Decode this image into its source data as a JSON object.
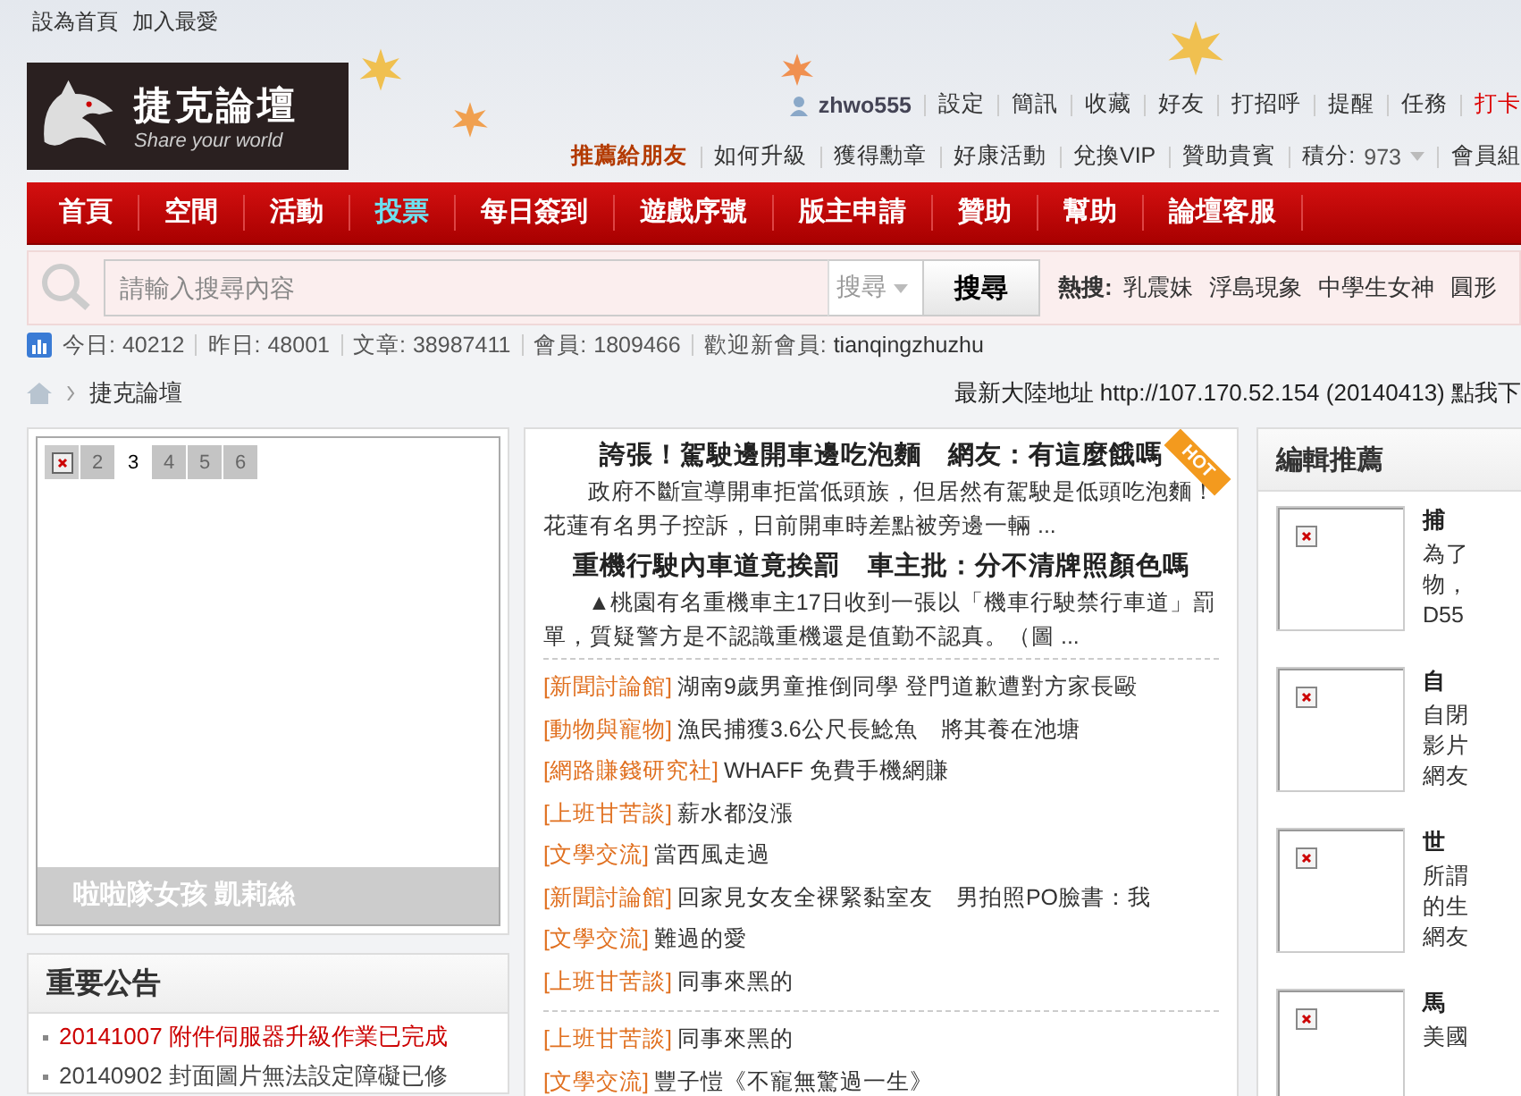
{
  "top_links": [
    "設為首頁",
    "加入最愛"
  ],
  "logo": {
    "title": "捷克論壇",
    "tagline": "Share your world"
  },
  "user_bar": {
    "username": "zhwo555",
    "links": [
      {
        "label": "設定",
        "highlight": false
      },
      {
        "label": "簡訊",
        "highlight": false
      },
      {
        "label": "收藏",
        "highlight": false
      },
      {
        "label": "好友",
        "highlight": false
      },
      {
        "label": "打招呼",
        "highlight": false
      },
      {
        "label": "提醒",
        "highlight": false
      },
      {
        "label": "任務",
        "highlight": false
      },
      {
        "label": "打卡",
        "highlight": true
      }
    ]
  },
  "sub_bar": {
    "recommend": "推薦給朋友",
    "links": [
      "如何升級",
      "獲得勳章",
      "好康活動",
      "兌換VIP",
      "贊助貴賓"
    ],
    "points_label": "積分:",
    "points": "973",
    "group": "會員組"
  },
  "nav": [
    {
      "label": "首頁",
      "selected": false
    },
    {
      "label": "空間",
      "selected": false
    },
    {
      "label": "活動",
      "selected": false
    },
    {
      "label": "投票",
      "selected": true
    },
    {
      "label": "每日簽到",
      "selected": false
    },
    {
      "label": "遊戲序號",
      "selected": false
    },
    {
      "label": "版主申請",
      "selected": false
    },
    {
      "label": "贊助",
      "selected": false
    },
    {
      "label": "幫助",
      "selected": false
    },
    {
      "label": "論壇客服",
      "selected": false
    }
  ],
  "search": {
    "placeholder": "請輸入搜尋內容",
    "scope": "搜尋",
    "button": "搜尋",
    "hot_label": "熱搜:",
    "hot": [
      "乳震妹",
      "浮島現象",
      "中學生女神",
      "圓形"
    ]
  },
  "stats": [
    {
      "label": "今日:",
      "value": "40212"
    },
    {
      "label": "昨日:",
      "value": "48001"
    },
    {
      "label": "文章:",
      "value": "38987411"
    },
    {
      "label": "會員:",
      "value": "1809466"
    },
    {
      "label": "歡迎新會員:",
      "value": "tianqingzhuzhu"
    }
  ],
  "breadcrumb": {
    "item": "捷克論壇",
    "notice": "最新大陸地址 http://107.170.52.154 (20140413) 點我下"
  },
  "slideshow": {
    "tabs": [
      {
        "kind": "image",
        "selected": false
      },
      {
        "kind": "number",
        "label": "2",
        "selected": false
      },
      {
        "kind": "number",
        "label": "3",
        "selected": true
      },
      {
        "kind": "number",
        "label": "4",
        "selected": false
      },
      {
        "kind": "number",
        "label": "5",
        "selected": false
      },
      {
        "kind": "number",
        "label": "6",
        "selected": false
      }
    ],
    "caption": "啦啦隊女孩 凱莉絲"
  },
  "announcements": {
    "title": "重要公告",
    "items": [
      {
        "text": "20141007 附件伺服器升級作業已完成",
        "highlight": true
      },
      {
        "text": "20140902 封面圖片無法設定障礙已修",
        "highlight": false
      }
    ]
  },
  "headlines": [
    {
      "title": "誇張！駕駛邊開車邊吃泡麵　網友：有這麼餓嗎",
      "summary": "政府不斷宣導開車拒當低頭族，但居然有駕駛是低頭吃泡麵！花蓮有名男子控訴，日前開車時差點被旁邊一輛 ...",
      "badge": "HOT"
    },
    {
      "title": "重機行駛內車道竟挨罰　車主批：分不清牌照顏色嗎",
      "summary": "▲桃園有名重機車主17日收到一張以「機車行駛禁行車道」罰單，質疑警方是不認識重機還是值勤不認真。（圖 ..."
    }
  ],
  "topic_groups": [
    [
      {
        "category": "[新聞討論館]",
        "title": "湖南9歲男童推倒同學 登門道歉遭對方家長毆"
      },
      {
        "category": "[動物與寵物]",
        "title": "漁民捕獲3.6公尺長鯰魚　將其養在池塘"
      },
      {
        "category": "[網路賺錢研究社]",
        "title": "WHAFF 免費手機網賺"
      },
      {
        "category": "[上班甘苦談]",
        "title": "薪水都沒漲"
      },
      {
        "category": "[文學交流]",
        "title": "當西風走過"
      },
      {
        "category": "[新聞討論館]",
        "title": "回家見女友全裸緊黏室友　男拍照PO臉書：我"
      },
      {
        "category": "[文學交流]",
        "title": "難過的愛"
      },
      {
        "category": "[上班甘苦談]",
        "title": "同事來黑的"
      }
    ],
    [
      {
        "category": "[上班甘苦談]",
        "title": "同事來黑的"
      },
      {
        "category": "[文學交流]",
        "title": "豐子愷《不寵無驚過一生》"
      }
    ]
  ],
  "editor_picks": {
    "title": "編輯推薦",
    "items": [
      {
        "title": "捕",
        "lines": [
          "為了",
          "物，",
          "D55"
        ]
      },
      {
        "title": "自",
        "lines": [
          "自閉",
          "影片",
          "網友"
        ]
      },
      {
        "title": "世",
        "lines": [
          "所謂",
          "的生",
          "網友"
        ]
      },
      {
        "title": "馬",
        "lines": [
          "美國"
        ]
      }
    ]
  }
}
